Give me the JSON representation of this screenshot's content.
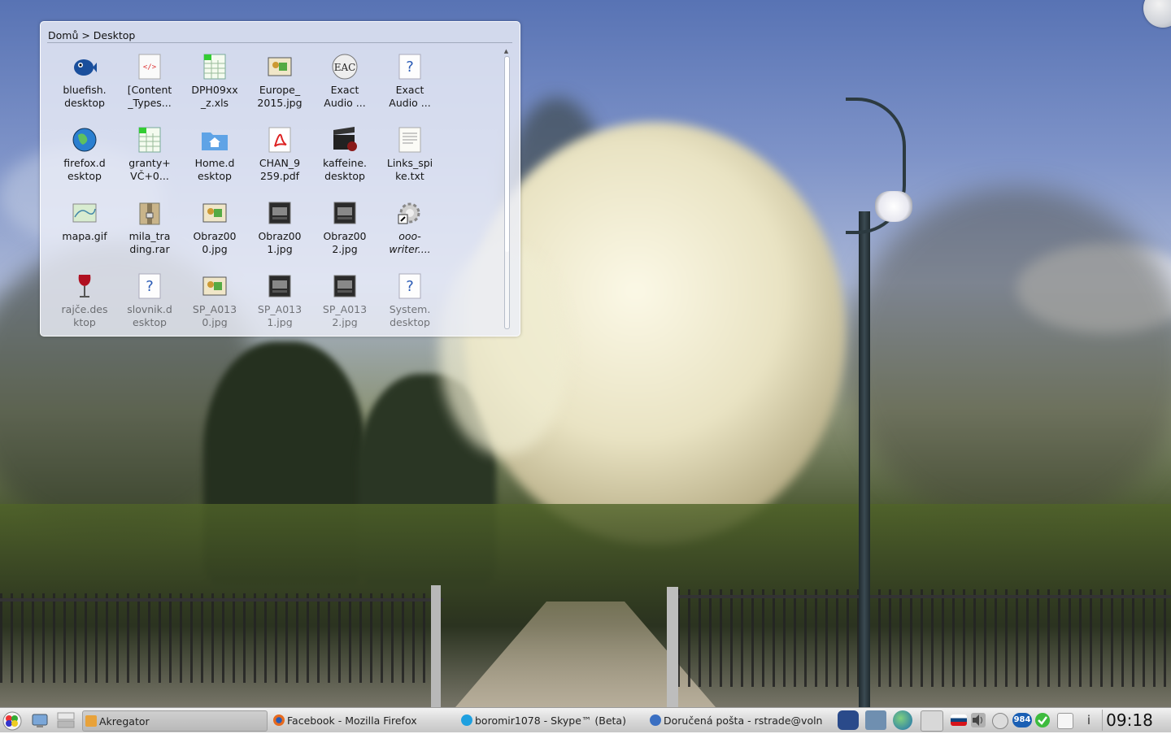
{
  "folder_view": {
    "breadcrumb": "Domů > Desktop",
    "items": [
      {
        "label": "bluefish.\ndesktop",
        "icon": "bluefish-icon",
        "italic": false
      },
      {
        "label": "[Content\n_Types...",
        "icon": "xml-file-icon",
        "italic": false
      },
      {
        "label": "DPH09xx\n_z.xls",
        "icon": "spreadsheet-icon",
        "italic": false
      },
      {
        "label": "Europe_\n2015.jpg",
        "icon": "image-thumbnail-icon",
        "italic": false
      },
      {
        "label": "Exact\nAudio ...",
        "icon": "eac-icon",
        "italic": false
      },
      {
        "label": "Exact\nAudio ...",
        "icon": "unknown-file-icon",
        "italic": false
      },
      {
        "label": "firefox.d\nesktop",
        "icon": "globe-icon",
        "italic": false
      },
      {
        "label": "granty+\nVČ+0...",
        "icon": "spreadsheet-icon",
        "italic": false
      },
      {
        "label": "Home.d\nesktop",
        "icon": "home-folder-icon",
        "italic": false
      },
      {
        "label": "CHAN_9\n259.pdf",
        "icon": "pdf-icon",
        "italic": false
      },
      {
        "label": "kaffeine.\ndesktop",
        "icon": "clapperboard-icon",
        "italic": false
      },
      {
        "label": "Links_spi\nke.txt",
        "icon": "text-file-icon",
        "italic": false
      },
      {
        "label": "mapa.gif",
        "icon": "map-image-icon",
        "italic": false
      },
      {
        "label": "mila_tra\nding.rar",
        "icon": "archive-icon",
        "italic": false
      },
      {
        "label": "Obraz00\n0.jpg",
        "icon": "image-thumbnail-icon",
        "italic": false
      },
      {
        "label": "Obraz00\n1.jpg",
        "icon": "dark-image-icon",
        "italic": false
      },
      {
        "label": "Obraz00\n2.jpg",
        "icon": "dark-image-icon",
        "italic": false
      },
      {
        "label": "ooo-\nwriter....",
        "icon": "gear-link-icon",
        "italic": true
      },
      {
        "label": "rajče.des\nktop",
        "icon": "wine-glass-icon",
        "italic": false
      },
      {
        "label": "slovnik.d\nesktop",
        "icon": "unknown-file-icon",
        "italic": false
      },
      {
        "label": "SP_A013\n0.jpg",
        "icon": "image-thumbnail-icon",
        "italic": false
      },
      {
        "label": "SP_A013\n1.jpg",
        "icon": "dark-image-icon",
        "italic": false
      },
      {
        "label": "SP_A013\n2.jpg",
        "icon": "dark-image-icon",
        "italic": false
      },
      {
        "label": "System.\ndesktop",
        "icon": "unknown-file-icon",
        "italic": false
      }
    ]
  },
  "taskbar": {
    "tasks": [
      {
        "label": "Akregator",
        "icon": "akregator-icon",
        "color": "#e8a23a"
      },
      {
        "label": "Facebook - Mozilla Firefox",
        "icon": "firefox-icon",
        "color": "#e66a1e"
      },
      {
        "label": "boromir1078 - Skype™ (Beta)",
        "icon": "skype-icon",
        "color": "#1ea0e0"
      },
      {
        "label": "Doručená pošta - rstrade@voln",
        "icon": "mail-icon",
        "color": "#3a6fc2"
      }
    ],
    "tray_badge": "984",
    "clock": "09:18",
    "info_glyph": "i"
  },
  "colors": {
    "taskbar_bg": "#d9d9d9",
    "widget_bg": "#ebeef8"
  }
}
